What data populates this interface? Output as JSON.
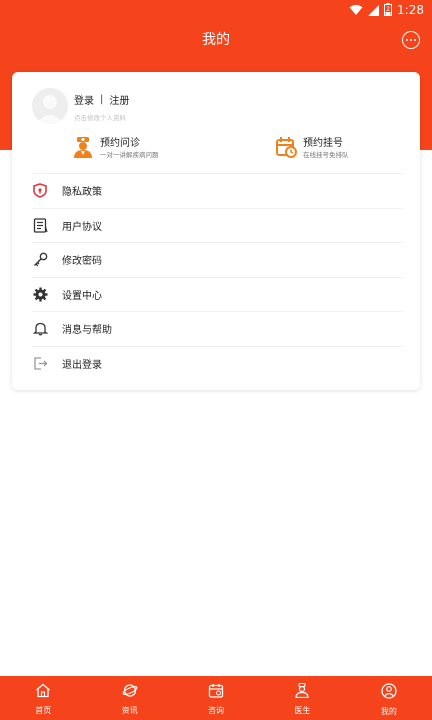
{
  "status_bar": {
    "time": "1:28",
    "battery_level": 2
  },
  "header": {
    "title": "我的"
  },
  "profile": {
    "login_label": "登录",
    "separator": "|",
    "register_label": "注册",
    "hint": "点击修改个人资料"
  },
  "quick_actions": [
    {
      "title": "预约问诊",
      "subtitle": "一对一讲解疾病问题",
      "icon": "doctor-icon"
    },
    {
      "title": "预约挂号",
      "subtitle": "在线挂号免排队",
      "icon": "calendar-clock-icon"
    }
  ],
  "menu": [
    {
      "label": "隐私政策",
      "icon": "shield-icon"
    },
    {
      "label": "用户协议",
      "icon": "document-icon"
    },
    {
      "label": "修改密码",
      "icon": "key-icon"
    },
    {
      "label": "设置中心",
      "icon": "gear-icon"
    },
    {
      "label": "消息与帮助",
      "icon": "bell-icon"
    },
    {
      "label": "退出登录",
      "icon": "logout-icon"
    }
  ],
  "tabs": [
    {
      "label": "首页",
      "icon": "home-icon",
      "active": false
    },
    {
      "label": "资讯",
      "icon": "planet-icon",
      "active": false
    },
    {
      "label": "咨询",
      "icon": "calendar-icon",
      "active": false
    },
    {
      "label": "医生",
      "icon": "doctor-tab-icon",
      "active": false
    },
    {
      "label": "我的",
      "icon": "user-icon",
      "active": true
    }
  ],
  "colors": {
    "brand": "#f5431b",
    "quick_icon": "#f0821e",
    "privacy_icon": "#e0383e"
  }
}
